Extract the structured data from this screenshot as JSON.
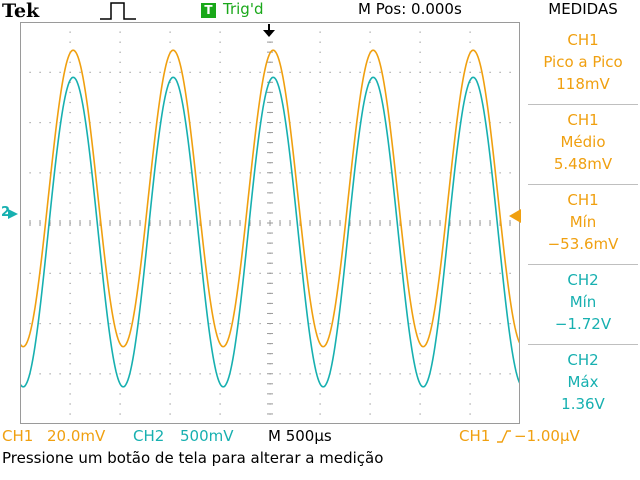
{
  "header": {
    "brand": "Tek",
    "trigger_badge": "T",
    "trigger_status": "Trig'd",
    "horizontal_position": "M Pos: 0.000s",
    "menu_title": "MEDIDAS"
  },
  "colors": {
    "ch1": "#f0a010",
    "ch2": "#17b0b0",
    "grid": "#9a9a9a",
    "trigger": "#1aa81a"
  },
  "measurements": [
    {
      "channel": "CH1",
      "label": "Pico a Pico",
      "value": "118mV"
    },
    {
      "channel": "CH1",
      "label": "Médio",
      "value": "5.48mV"
    },
    {
      "channel": "CH1",
      "label": "Mín",
      "value": "−53.6mV"
    },
    {
      "channel": "CH2",
      "label": "Mín",
      "value": "−1.72V"
    },
    {
      "channel": "CH2",
      "label": "Máx",
      "value": "1.36V"
    }
  ],
  "status": {
    "ch1_label": "CH1",
    "ch1_scale": "20.0mV",
    "ch2_label": "CH2",
    "ch2_scale": "500mV",
    "timebase": "M 500µs",
    "trigger_source": "CH1",
    "trigger_level": "−1.00µV"
  },
  "ch2_marker_label": "2",
  "message": "Pressione um botão de tela para alterar a medição",
  "chart_data": {
    "type": "line",
    "x_unit": "ms",
    "xlim": [
      -2.5,
      2.5
    ],
    "series": [
      {
        "name": "CH1",
        "waveform": "sine",
        "frequency_hz": 1000,
        "vmin_mV": -53.6,
        "vmax_mV": 64.4,
        "mean_mV": 5.48,
        "peak_to_peak_mV": 118,
        "phase_deg": 0
      },
      {
        "name": "CH2",
        "waveform": "sine",
        "frequency_hz": 1000,
        "vmin_V": -1.72,
        "vmax_V": 1.36,
        "phase_deg": 0
      }
    ]
  }
}
